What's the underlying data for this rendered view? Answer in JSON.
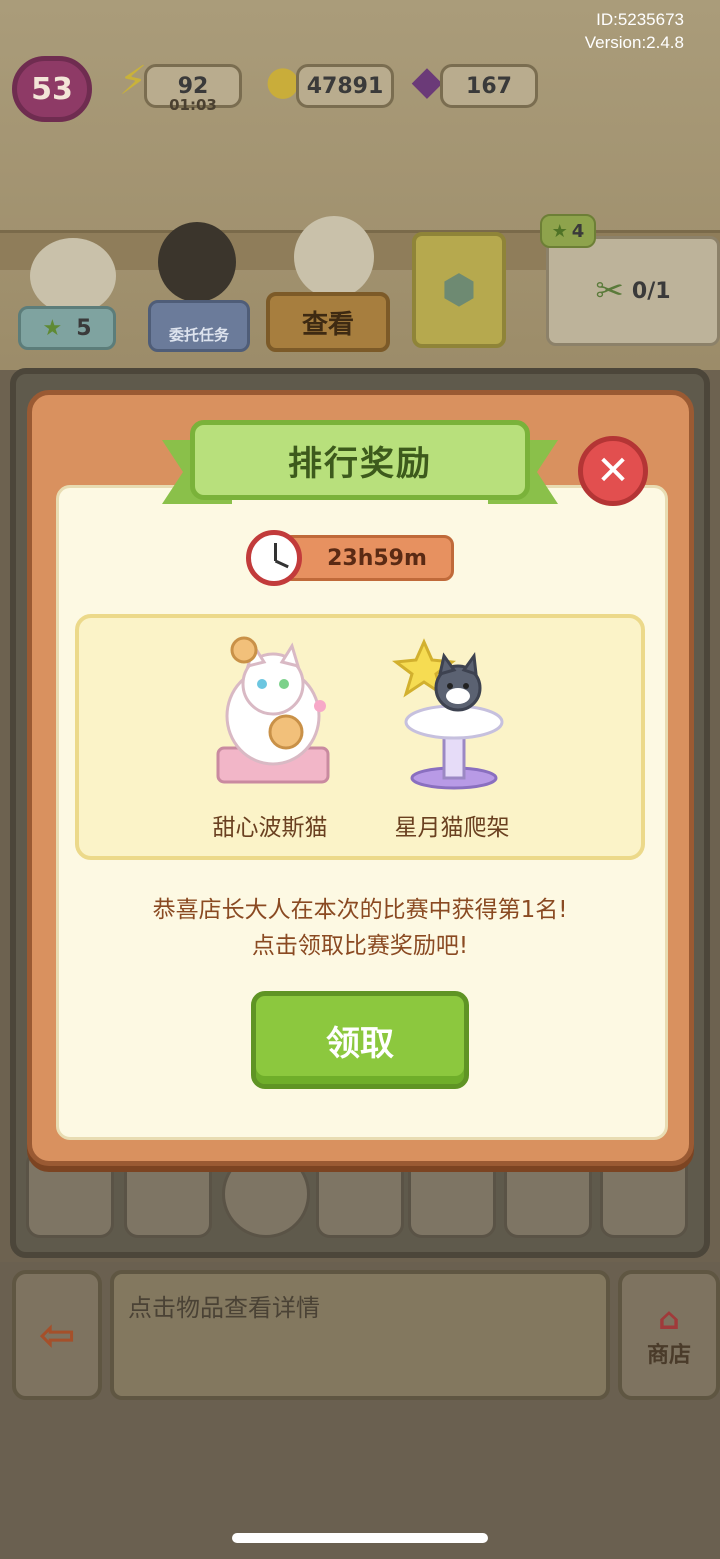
{
  "meta": {
    "id": "ID:5235673",
    "version": "Version:2.4.8"
  },
  "hud": {
    "level": "53",
    "energy": "92",
    "energy_timer": "01:03",
    "coins": "47891",
    "gems": "167"
  },
  "scene": {
    "star_count": "5",
    "commission_label": "委托任务",
    "view_label": "查看",
    "star_badge": "4",
    "progress": "0/1",
    "hint_text": "点击物品查看详情",
    "shop_label": "商店"
  },
  "modal": {
    "title": "排行奖励",
    "timer": "23h59m",
    "rewards": [
      {
        "name": "甜心波斯猫",
        "icon": "persian-cat-figure-icon"
      },
      {
        "name": "星月猫爬架",
        "icon": "star-moon-cat-tree-icon"
      }
    ],
    "message_line1": "恭喜店长大人在本次的比赛中获得第1名!",
    "message_line2": "点击领取比赛奖励吧!",
    "claim_label": "领取"
  },
  "colors": {
    "modal_frame": "#d9915f",
    "ribbon_green": "#b8e07c",
    "claim_green": "#8cc83e",
    "close_red": "#e24f4f"
  }
}
